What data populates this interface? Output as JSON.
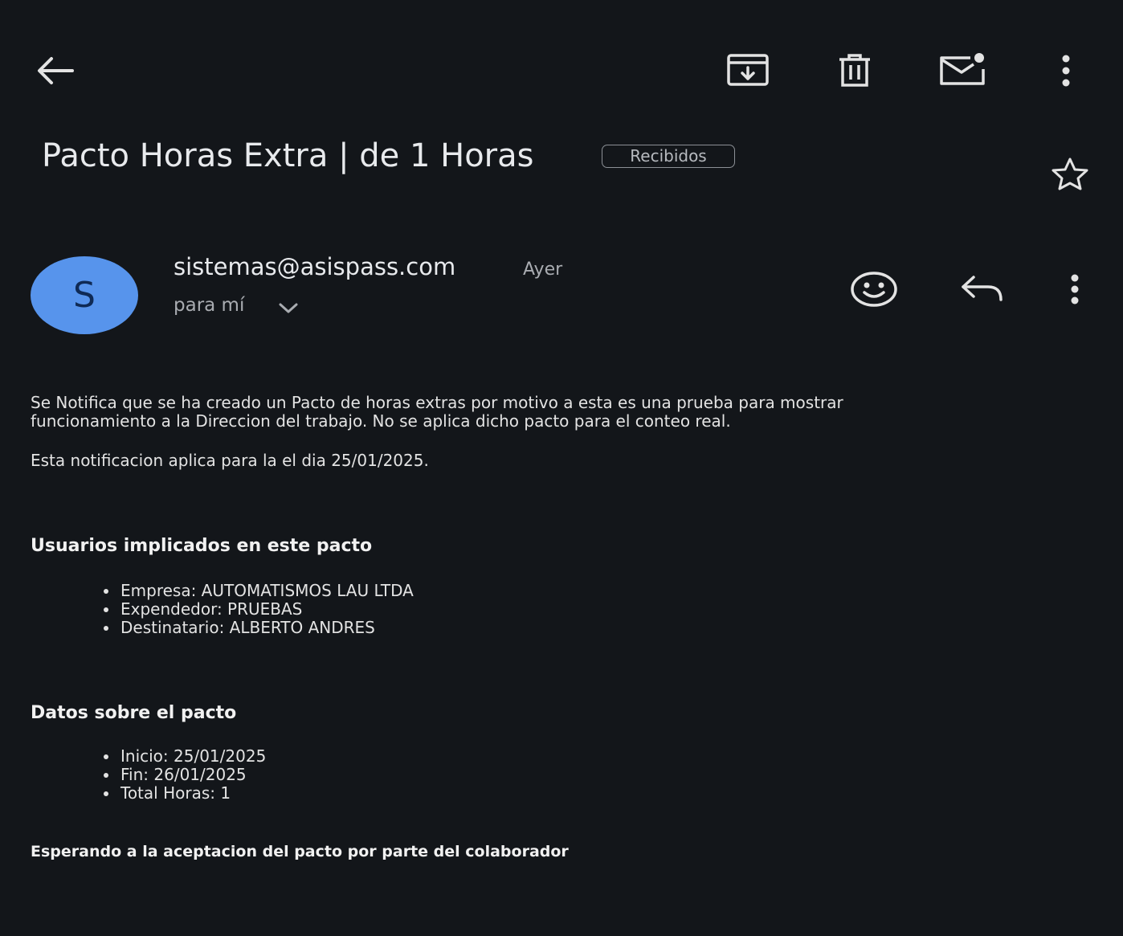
{
  "toolbar": {
    "back_icon": "arrow-left-icon",
    "archive_icon": "archive-icon",
    "delete_icon": "trash-icon",
    "mark_unread_icon": "mail-unread-icon",
    "more_icon": "more-vertical-icon"
  },
  "email": {
    "subject": "Pacto Horas Extra | de 1 Horas",
    "label": "Recibidos",
    "starred": false,
    "sender": {
      "avatar_letter": "S",
      "avatar_color": "#5794ec",
      "address": "sistemas@asispass.com",
      "time": "Ayer",
      "recipient": "para mí"
    },
    "body": {
      "intro_line1": "Se Notifica que se ha creado un Pacto de horas extras por motivo a esta es una prueba para mostrar",
      "intro_line2": "funcionamiento a la Direccion del trabajo. No se aplica dicho pacto para el conteo real.",
      "date_note": "Esta notificacion aplica para la el dia 25/01/2025.",
      "users_heading": "Usuarios implicados en este pacto",
      "users": [
        "Empresa: AUTOMATISMOS LAU LTDA",
        "Expendedor: PRUEBAS",
        "Destinatario: ALBERTO ANDRES"
      ],
      "data_heading": "Datos sobre el pacto",
      "data_items": [
        "Inicio: 25/01/2025",
        "Fin: 26/01/2025",
        "Total Horas: 1"
      ],
      "footer": "Esperando a la aceptacion del pacto por parte del colaborador"
    }
  },
  "colors": {
    "background": "#13161a",
    "text": "#e3e3e3",
    "secondary_text": "#a9acb1"
  }
}
